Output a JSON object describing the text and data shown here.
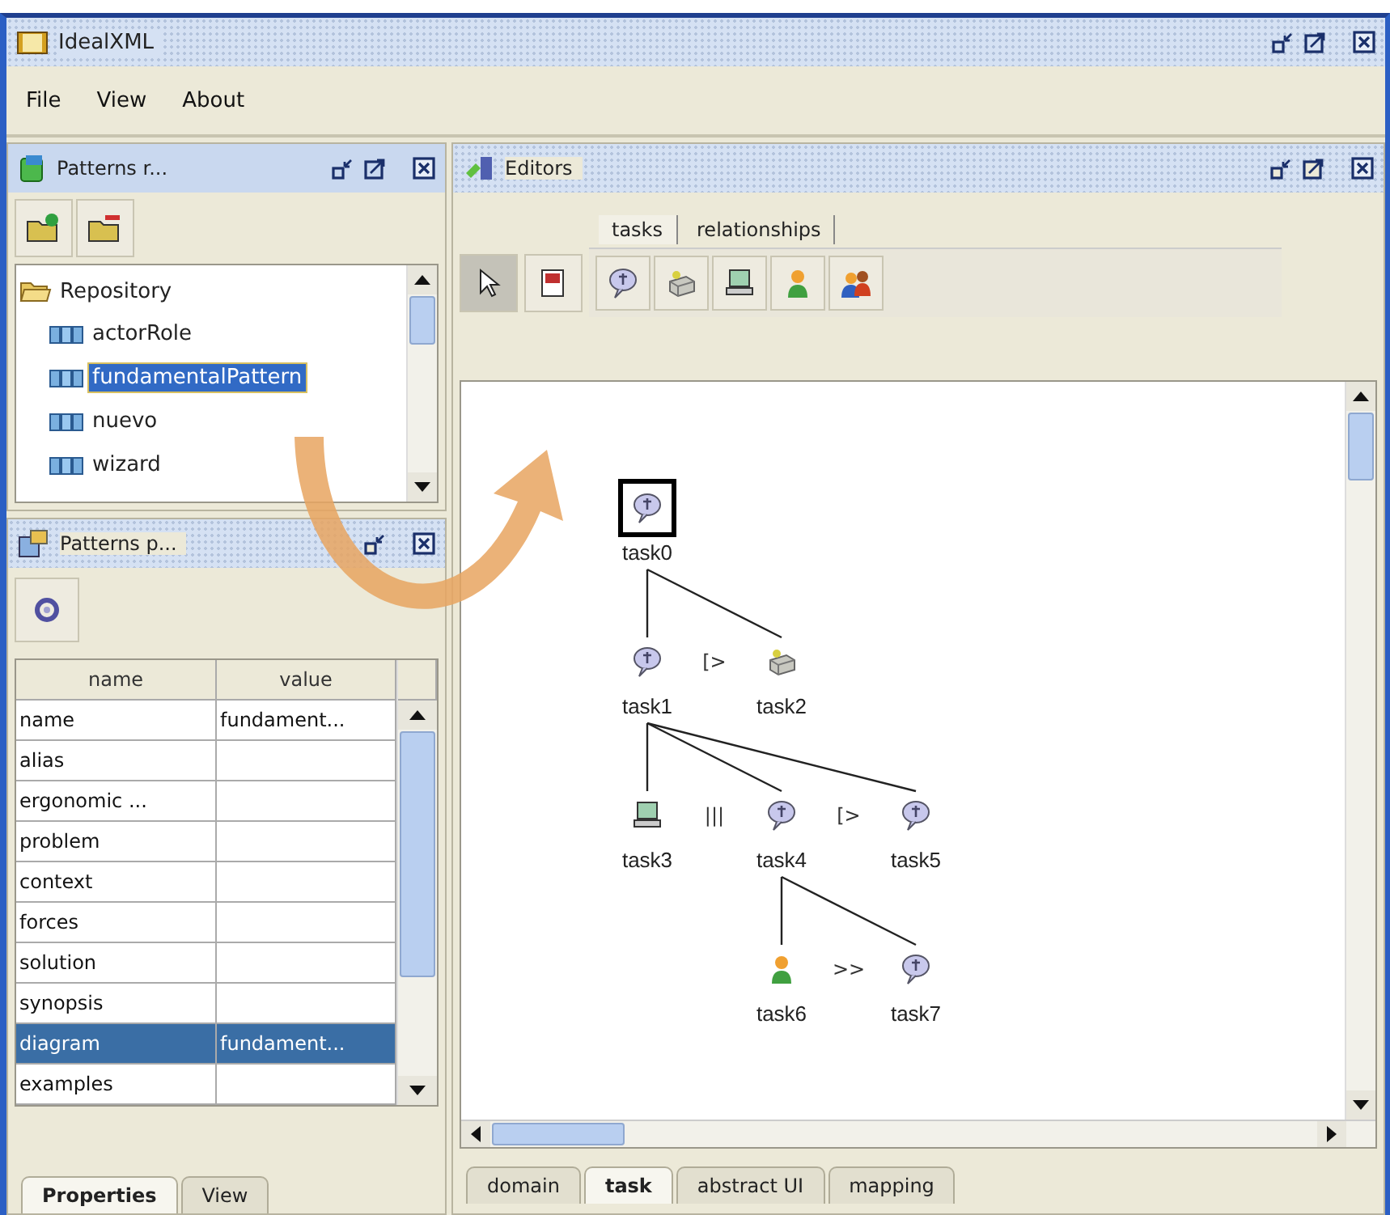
{
  "window": {
    "title": "IdealXML"
  },
  "menu": [
    "File",
    "View",
    "About"
  ],
  "repository_panel": {
    "title": "Patterns r...",
    "tree": {
      "label": "Repository",
      "expanded": true,
      "children": [
        {
          "label": "actorRole",
          "selected": false
        },
        {
          "label": "fundamentalPattern",
          "selected": true
        },
        {
          "label": "nuevo",
          "selected": false
        },
        {
          "label": "wizard",
          "selected": false
        }
      ]
    }
  },
  "properties_panel": {
    "title": "Patterns p...",
    "columns": [
      "name",
      "value"
    ],
    "rows": [
      {
        "name": "name",
        "value": "fundament...",
        "selected": false
      },
      {
        "name": "alias",
        "value": "",
        "selected": false
      },
      {
        "name": "ergonomic ...",
        "value": "",
        "selected": false
      },
      {
        "name": "problem",
        "value": "",
        "selected": false
      },
      {
        "name": "context",
        "value": "",
        "selected": false
      },
      {
        "name": "forces",
        "value": "",
        "selected": false
      },
      {
        "name": "solution",
        "value": "",
        "selected": false
      },
      {
        "name": "synopsis",
        "value": "",
        "selected": false
      },
      {
        "name": "diagram",
        "value": "fundament...",
        "selected": true
      },
      {
        "name": "examples",
        "value": "",
        "selected": false
      }
    ],
    "tabs": [
      {
        "label": "Properties",
        "selected": true
      },
      {
        "label": "View",
        "selected": false
      }
    ]
  },
  "editors_panel": {
    "title": "Editors",
    "tools": [
      {
        "kind": "pointer",
        "selected": true
      },
      {
        "kind": "export",
        "selected": false
      }
    ],
    "palette_tabs": [
      {
        "label": "tasks",
        "selected": true
      },
      {
        "label": "relationships",
        "selected": false
      }
    ],
    "palette": [
      {
        "kind": "interaction"
      },
      {
        "kind": "system"
      },
      {
        "kind": "application"
      },
      {
        "kind": "user"
      },
      {
        "kind": "cooperative"
      }
    ],
    "diagram": {
      "label": "task0",
      "kind": "interaction",
      "selected": true,
      "children": [
        {
          "label": "task1",
          "kind": "interaction",
          "selected": false,
          "operator": "[>",
          "children": [
            {
              "label": "task3",
              "kind": "application",
              "selected": false,
              "operator": "|||"
            },
            {
              "label": "task4",
              "kind": "interaction",
              "selected": false,
              "operator": "[>",
              "children": [
                {
                  "label": "task6",
                  "kind": "user",
                  "selected": false,
                  "operator": ">>"
                },
                {
                  "label": "task7",
                  "kind": "interaction",
                  "selected": false
                }
              ]
            },
            {
              "label": "task5",
              "kind": "interaction",
              "selected": false
            }
          ]
        },
        {
          "label": "task2",
          "kind": "system",
          "selected": false
        }
      ]
    },
    "tabs": [
      {
        "label": "domain",
        "selected": false
      },
      {
        "label": "task",
        "selected": true
      },
      {
        "label": "abstract UI",
        "selected": false
      },
      {
        "label": "mapping",
        "selected": false
      }
    ]
  }
}
